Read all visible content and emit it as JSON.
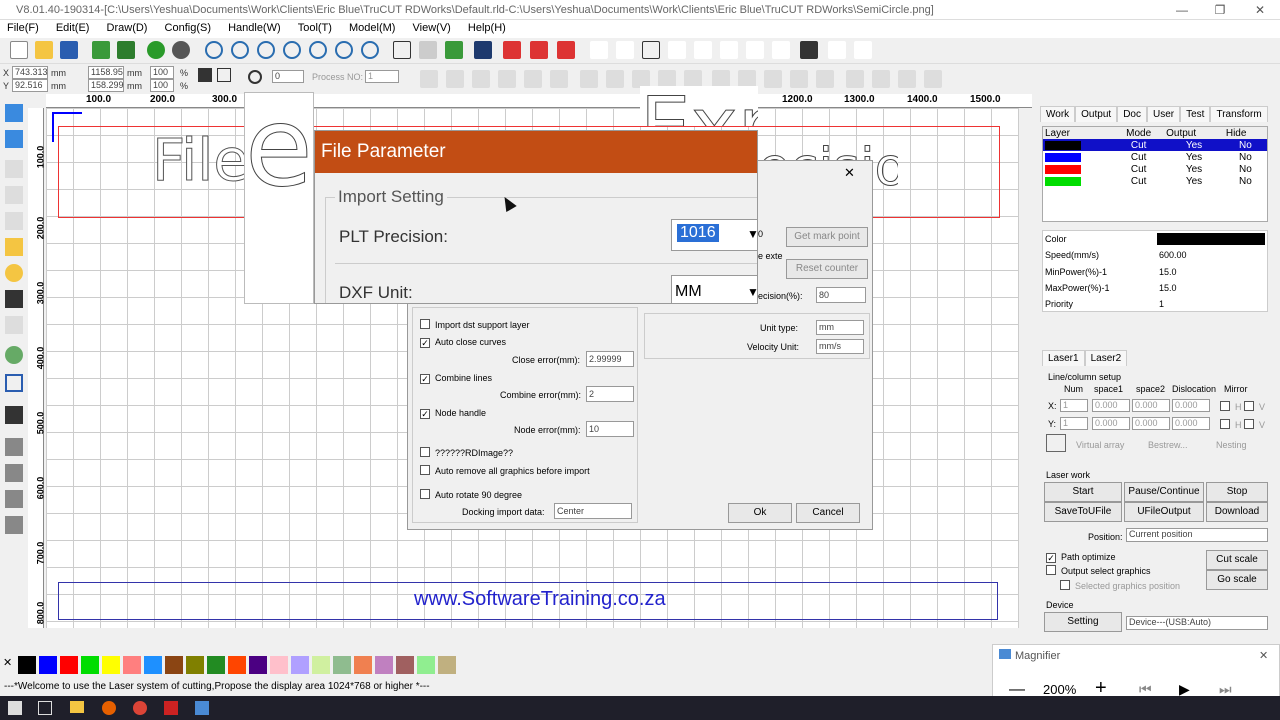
{
  "window": {
    "title": "V8.01.40-190314-[C:\\Users\\Yeshua\\Documents\\Work\\Clients\\Eric Blue\\TruCUT RDWorks\\Default.rld-C:\\Users\\Yeshua\\Documents\\Work\\Clients\\Eric Blue\\TruCUT RDWorks\\SemiCircle.png]",
    "min": "—",
    "max": "❐",
    "close": "✕"
  },
  "menu": [
    "File(F)",
    "Edit(E)",
    "Draw(D)",
    "Config(S)",
    "Handle(W)",
    "Tool(T)",
    "Model(M)",
    "View(V)",
    "Help(H)"
  ],
  "props": {
    "x_label": "X",
    "x_val": "743.313",
    "x_unit": "mm",
    "y_label": "Y",
    "y_val": "92.516",
    "y_unit": "mm",
    "w_val": "1158.95",
    "w_unit": "mm",
    "h_val": "158.299",
    "h_unit": "mm",
    "sx": "100",
    "sy": "100",
    "pct1": "%",
    "pct2": "%",
    "rot": "0",
    "process_label": "Process NO:",
    "process_val": "1"
  },
  "ruler": {
    "h": [
      "100.0",
      "200.0",
      "300.0",
      "1200.0",
      "1300.0",
      "1400.0",
      "1500.0"
    ],
    "v": [
      "100.0",
      "200.0",
      "300.0",
      "400.0",
      "500.0",
      "600.0",
      "700.0",
      "800.0"
    ]
  },
  "canvas": {
    "text_top": "File",
    "text_bottom": "www.SoftwareTraining.co.za",
    "bg_text1": "ettings",
    "bg_text2": "Exp",
    "bg_text3": "ecision"
  },
  "file_param": {
    "title": "File Parameter",
    "group": "Import Setting",
    "plt_label": "PLT Precision:",
    "plt_val": "1016",
    "dxf_label": "DXF Unit:",
    "dxf_val": "MM"
  },
  "import_dlg": {
    "dst": "Import dst support layer",
    "auto_close": "Auto close curves",
    "close_err_label": "Close error(mm):",
    "close_err": "2.99999",
    "combine": "Combine lines",
    "combine_err_label": "Combine error(mm):",
    "combine_err": "2",
    "node": "Node handle",
    "node_err_label": "Node error(mm):",
    "node_err": "10",
    "rdimage": "??????RDImage??",
    "auto_remove": "Auto remove all graphics before import",
    "auto_rotate": "Auto rotate 90 degree",
    "dock_label": "Docking import data:",
    "dock_val": "Center",
    "get_mark": "Get mark point",
    "reset": "Reset counter",
    "exte": "e exte",
    "prec_label": "ecision(%):",
    "prec_val": "80",
    "unit_label": "Unit type:",
    "unit_val": "mm",
    "vel_label": "Velocity Unit:",
    "vel_val": "mm/s",
    "ok": "Ok",
    "cancel": "Cancel",
    "close": "✕",
    "zero": "0"
  },
  "panel": {
    "tabs": [
      "Work",
      "Output",
      "Doc",
      "User",
      "Test",
      "Transform"
    ],
    "layer_head": [
      "Layer",
      "Mode",
      "Output",
      "Hide"
    ],
    "layers": [
      {
        "color": "#000000",
        "mode": "Cut",
        "output": "Yes",
        "hide": "No"
      },
      {
        "color": "#0000ff",
        "mode": "Cut",
        "output": "Yes",
        "hide": "No"
      },
      {
        "color": "#ff0000",
        "mode": "Cut",
        "output": "Yes",
        "hide": "No"
      },
      {
        "color": "#00dd00",
        "mode": "Cut",
        "output": "Yes",
        "hide": "No"
      }
    ],
    "params": [
      {
        "k": "Color",
        "v": ""
      },
      {
        "k": "Speed(mm/s)",
        "v": "600.00"
      },
      {
        "k": "MinPower(%)-1",
        "v": "15.0"
      },
      {
        "k": "MaxPower(%)-1",
        "v": "15.0"
      },
      {
        "k": "Priority",
        "v": "1"
      }
    ],
    "laser_tabs": [
      "Laser1",
      "Laser2"
    ],
    "lc": "Line/column setup",
    "num": "Num",
    "sp1": "space1",
    "sp2": "space2",
    "disl": "Dislocation",
    "mirror": "Mirror",
    "xl": "X:",
    "yl": "Y:",
    "one": "1",
    "zero": "0.000",
    "h": "H",
    "v": "V",
    "virtual": "Virtual array",
    "bestrew": "Bestrew...",
    "nesting": "Nesting",
    "lw": "Laser work",
    "start": "Start",
    "pause": "Pause/Continue",
    "stop": "Stop",
    "save_file": "SaveToUFile",
    "ufile": "UFileOutput",
    "download": "Download",
    "pos_label": "Position:",
    "pos_val": "Current position",
    "path": "Path optimize",
    "out_sel": "Output select graphics",
    "sel_pos": "Selected graphics position",
    "cut_scale": "Cut scale",
    "go_scale": "Go scale",
    "device": "Device",
    "setting": "Setting",
    "device_val": "Device---(USB:Auto)"
  },
  "palette": [
    "#000000",
    "#0000ff",
    "#ff0000",
    "#00dd00",
    "#ffff00",
    "#ff7f7f",
    "#1e90ff",
    "#8b4513",
    "#808000",
    "#228b22",
    "#ff4500",
    "#4b0082",
    "#ffc0cb",
    "#b0a0ff",
    "#d0f0a0",
    "#8fbc8f",
    "#f08050",
    "#c080c0",
    "#a06060",
    "#90ee90",
    "#c0b080"
  ],
  "palette_x": "✕",
  "status": "---*Welcome to use the Laser system of cutting,Propose the display area 1024*768 or higher *---",
  "magnifier": {
    "title": "Magnifier",
    "zoom": "200%",
    "minus": "—",
    "plus": "+",
    "close": "✕"
  }
}
